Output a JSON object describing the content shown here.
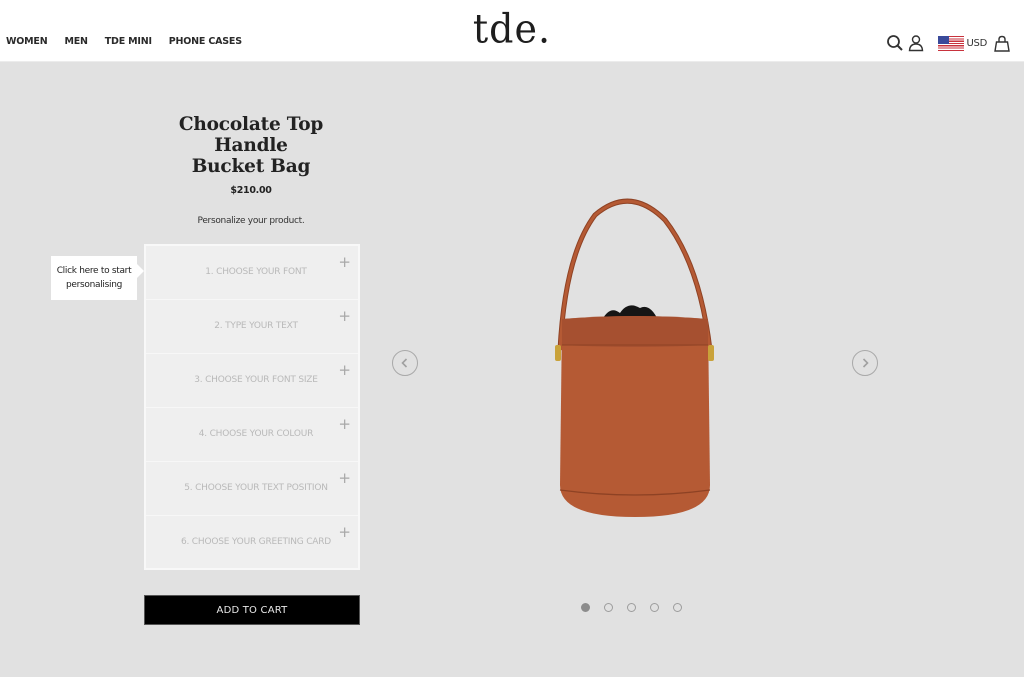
{
  "header": {
    "nav": [
      {
        "label": "WOMEN"
      },
      {
        "label": "MEN"
      },
      {
        "label": "TDE MINI"
      },
      {
        "label": "PHONE CASES"
      }
    ],
    "logo": "tde.",
    "icons": [
      "search-icon",
      "account-icon",
      "us-flag-icon",
      "shopping-bag-icon"
    ],
    "currency": "USD"
  },
  "product": {
    "title_line1": "Chocolate Top Handle",
    "title_line2": "Bucket Bag",
    "price": "$210.00",
    "personalize_text": "Personalize your product.",
    "tooltip_line1": "Click here to start",
    "tooltip_line2": "personalising",
    "steps": [
      {
        "label": "1. CHOOSE YOUR FONT"
      },
      {
        "label": "2. TYPE YOUR TEXT"
      },
      {
        "label": "3. CHOOSE YOUR FONT SIZE"
      },
      {
        "label": "4. CHOOSE YOUR COLOUR"
      },
      {
        "label": "5. CHOOSE YOUR TEXT POSITION"
      },
      {
        "label": "6. CHOOSE YOUR GREETING CARD"
      }
    ],
    "step_expand_symbol": "+",
    "add_to_cart": "ADD TO CART"
  },
  "gallery": {
    "image_count": 5,
    "active_index": 0,
    "prev_icon": "chevron-left-icon",
    "next_icon": "chevron-right-icon",
    "colors": {
      "leather": "#b55a34",
      "leather_dark": "#8e4224",
      "hardware": "#c9a23a"
    }
  },
  "colors": {
    "page_bg": "#e1e1e1",
    "header_bg": "#ffffff",
    "button_bg": "#000000",
    "step_bg": "#efefef",
    "step_text": "#b9b9b9"
  }
}
